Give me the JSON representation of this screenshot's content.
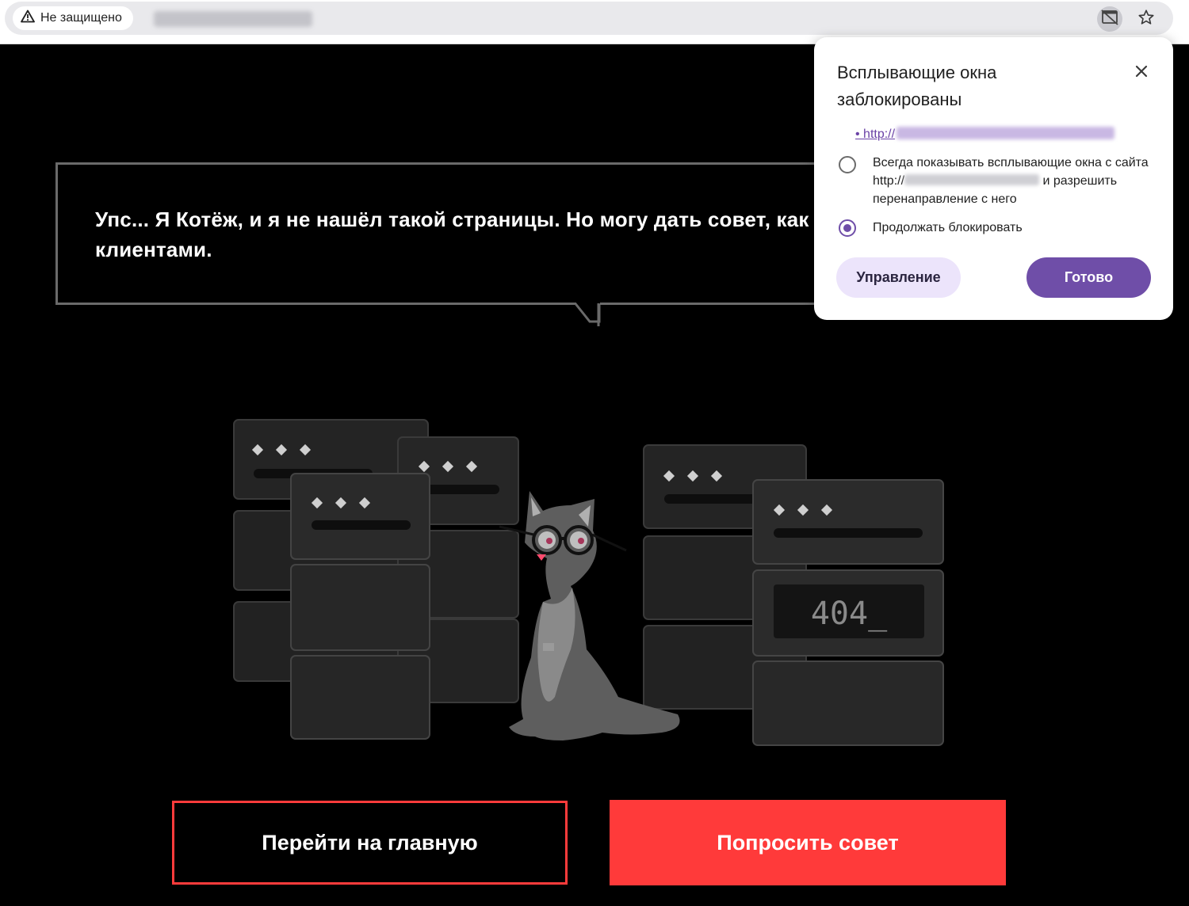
{
  "browser": {
    "security_label": "Не защищено",
    "security_icon": "warning-triangle-icon",
    "popup_blocked_icon": "popup-blocked-icon",
    "bookmark_icon": "star-icon"
  },
  "page": {
    "bubble_text_line1": "Упс... Я Котёж, и я не нашёл такой страницы. Но могу дать совет, как",
    "bubble_text_line2": "клиентами.",
    "error_screen_text": "404_",
    "home_button": "Перейти на главную",
    "advice_button": "Попросить совет",
    "colors": {
      "background": "#000000",
      "accent": "#ff3a3a"
    }
  },
  "popup_dialog": {
    "title": "Всплывающие окна заблокированы",
    "link_prefix": "• http://",
    "option_always_part1": "Всегда показывать всплывающие окна с сайта http://",
    "option_always_part2": " и разрешить перенаправление с него",
    "option_block": "Продолжать блокировать",
    "selected_option": "block",
    "manage_button": "Управление",
    "done_button": "Готово",
    "colors": {
      "primary": "#6f4ea8",
      "secondary_bg": "#ece4fb"
    }
  }
}
